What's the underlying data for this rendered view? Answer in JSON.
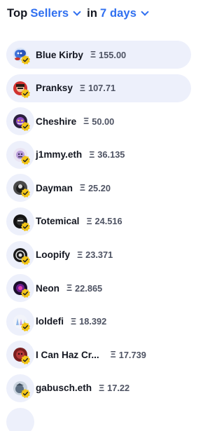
{
  "header": {
    "prefix": "Top",
    "category": "Sellers",
    "connector": "in",
    "period": "7 days"
  },
  "currency_symbol": "Ξ",
  "colors": {
    "accent": "#2f6ff0",
    "pill_background": "#edf0fb",
    "verified_badge": "#f2c518"
  },
  "sellers": [
    {
      "name": "Blue Kirby",
      "volume": "155.00",
      "avatar_icon": "blue-kirby-avatar-icon"
    },
    {
      "name": "Pranksy",
      "volume": "107.71",
      "avatar_icon": "pranksy-avatar-icon"
    },
    {
      "name": "Cheshire",
      "volume": "50.00",
      "avatar_icon": "cheshire-avatar-icon"
    },
    {
      "name": "j1mmy.eth",
      "volume": "36.135",
      "avatar_icon": "j1mmy-avatar-icon"
    },
    {
      "name": "Dayman",
      "volume": "25.20",
      "avatar_icon": "dayman-avatar-icon"
    },
    {
      "name": "Totemical",
      "volume": "24.516",
      "avatar_icon": "totemical-avatar-icon"
    },
    {
      "name": "Loopify",
      "volume": "23.371",
      "avatar_icon": "loopify-avatar-icon"
    },
    {
      "name": "Neon",
      "volume": "22.865",
      "avatar_icon": "neon-avatar-icon"
    },
    {
      "name": "loldefi",
      "volume": "18.392",
      "avatar_icon": "loldefi-avatar-icon"
    },
    {
      "name": "I Can Haz Cr...",
      "volume": "17.739",
      "avatar_icon": "i-can-haz-avatar-icon"
    },
    {
      "name": "gabusch.eth",
      "volume": "17.22",
      "avatar_icon": "gabusch-avatar-icon"
    }
  ]
}
